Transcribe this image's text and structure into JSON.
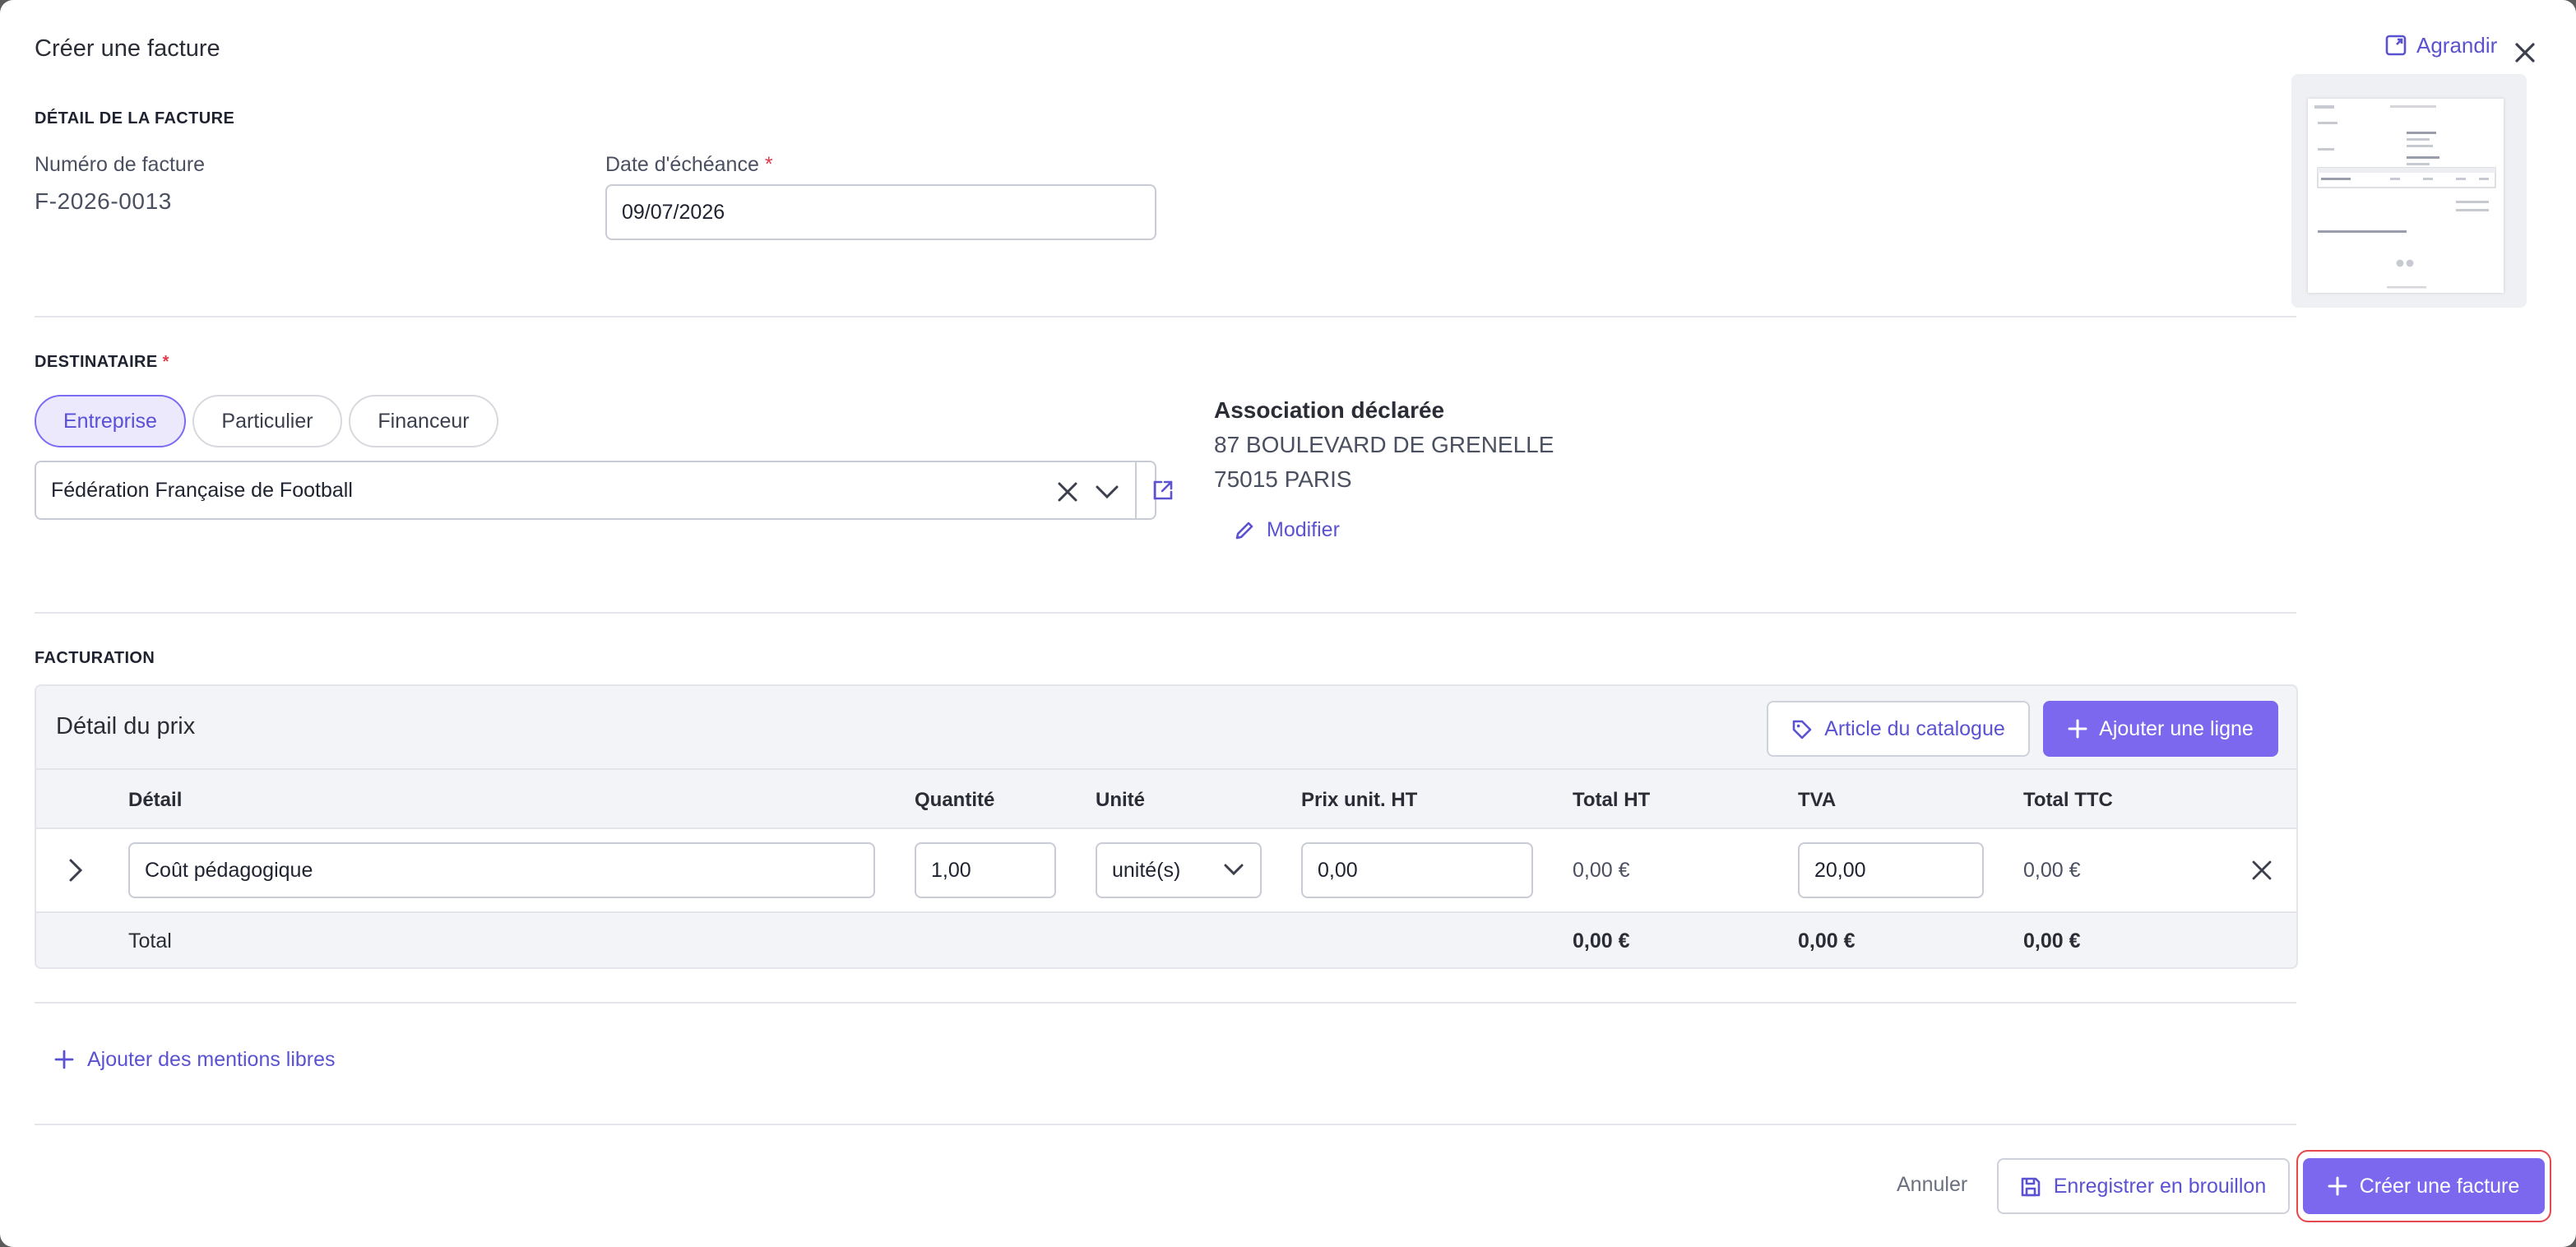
{
  "modal": {
    "title": "Créer une facture",
    "expand_label": "Agrandir"
  },
  "invoice_detail": {
    "section_label": "DÉTAIL DE LA FACTURE",
    "number_label": "Numéro de facture",
    "number_value": "F-2026-0013",
    "due_date_label": "Date d'échéance",
    "due_date_value": "09/07/2026",
    "required_mark": "*"
  },
  "recipient": {
    "section_label": "DESTINATAIRE",
    "required_mark": "*",
    "types": [
      "Entreprise",
      "Particulier",
      "Financeur"
    ],
    "selected_type": "Entreprise",
    "selected_org": "Fédération Française de Football",
    "address_name": "Association déclarée",
    "address_line1": "87 BOULEVARD DE GRENELLE",
    "address_line2": "75015 PARIS",
    "edit_label": "Modifier"
  },
  "billing": {
    "section_label": "FACTURATION",
    "panel_title": "Détail du prix",
    "catalog_button": "Article du catalogue",
    "add_line_button": "Ajouter une ligne",
    "columns": [
      "Détail",
      "Quantité",
      "Unité",
      "Prix unit. HT",
      "Total HT",
      "TVA",
      "Total TTC"
    ],
    "rows": [
      {
        "detail": "Coût pédagogique",
        "quantity": "1,00",
        "unit": "unité(s)",
        "unit_price": "0,00",
        "total_ht": "0,00 €",
        "tva": "20,00",
        "total_ttc": "0,00 €"
      }
    ],
    "totals": {
      "label": "Total",
      "total_ht": "0,00 €",
      "tva": "0,00 €",
      "total_ttc": "0,00 €"
    }
  },
  "mentions": {
    "add_label": "Ajouter des mentions libres"
  },
  "footer": {
    "cancel": "Annuler",
    "save_draft": "Enregistrer en brouillon",
    "create": "Créer une facture"
  },
  "colors": {
    "accent": "#7b68ee",
    "link": "#5b52d1",
    "required": "#e0394a",
    "highlight": "#e5484d"
  }
}
